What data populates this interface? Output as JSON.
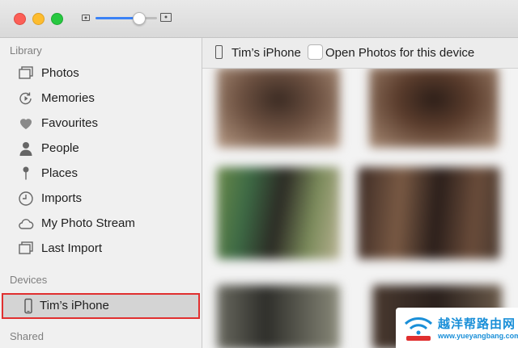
{
  "window": {
    "traffic_lights": {
      "close": "#fc5f57",
      "minimize": "#fdbc2e",
      "maximize": "#27c840"
    },
    "zoom_slider": {
      "value": 0.7
    }
  },
  "sidebar": {
    "library": {
      "heading": "Library",
      "items": [
        {
          "label": "Photos",
          "icon": "photos-icon"
        },
        {
          "label": "Memories",
          "icon": "memories-icon"
        },
        {
          "label": "Favourites",
          "icon": "heart-icon"
        },
        {
          "label": "People",
          "icon": "person-icon"
        },
        {
          "label": "Places",
          "icon": "pin-icon"
        },
        {
          "label": "Imports",
          "icon": "clock-icon"
        },
        {
          "label": "My Photo Stream",
          "icon": "cloud-icon"
        },
        {
          "label": "Last Import",
          "icon": "photos-icon"
        }
      ]
    },
    "devices": {
      "heading": "Devices",
      "items": [
        {
          "label": "Tim’s iPhone",
          "icon": "iphone-icon",
          "selected": true
        }
      ]
    },
    "shared": {
      "heading": "Shared"
    }
  },
  "main": {
    "device_name": "Tim’s iPhone",
    "open_photos_label": "Open Photos for this device",
    "open_photos_checked": false
  },
  "watermark": {
    "title": "越洋帮路由网",
    "url": "www.yueyangbang.com"
  },
  "colors": {
    "accent": "#3b82f6",
    "selection_outline": "#e02f2f",
    "watermark": "#1a8fd8"
  }
}
